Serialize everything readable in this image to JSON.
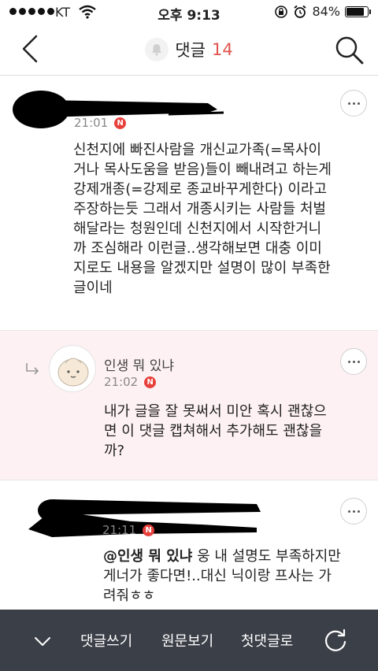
{
  "status_bar": {
    "carrier": "KT",
    "time": "오후 9:13",
    "battery": "84%",
    "battery_level": 0.84
  },
  "header": {
    "title": "댓글",
    "count": "14",
    "icons": [
      "back-chevron-icon",
      "bell-icon",
      "search-icon"
    ]
  },
  "comments": [
    {
      "time": "21:01",
      "badge": "N",
      "author_redacted": true,
      "lines": [
        "신천지에 빠진사람을 개신교가족(=목사이",
        "거나 목사도움을 받음)들이 빼내려고 하는게",
        "강제개종(=강제로 종교바꾸게한다) 이라고",
        "주장하는듯 그래서 개종시키는 사람들 처벌",
        "해달라는 청원인데 신천지에서 시작한거니",
        "까 조심해라 이런글..생각해보면 대충 이미",
        "지로도 내용을 알겠지만 설명이 많이 부족한",
        "글이네"
      ]
    },
    {
      "author": "인생 뭐 있냐",
      "time": "21:02",
      "badge": "N",
      "lines": [
        "내가 글을 잘 못써서 미안 혹시 괜찮으",
        "면 이 댓글 캡쳐해서 추가해도 괜찮을",
        "까?"
      ]
    },
    {
      "time": "21:11",
      "badge": "N",
      "author_redacted": true,
      "mention": "@인생 뭐 있냐",
      "lines": [
        " 웅 내 설명도 부족하지만",
        "게너가 좋다면!..대신 닉이랑 프사는 가",
        "려줘ㅎㅎ"
      ]
    }
  ],
  "bottom_bar": {
    "write": "댓글쓰기",
    "view_original": "원문보기",
    "first_comment": "첫댓글로"
  },
  "colors": {
    "accent": "#e0534d",
    "reply_bg": "#fdf1f3",
    "toolbar_bg": "#3b3f47"
  }
}
